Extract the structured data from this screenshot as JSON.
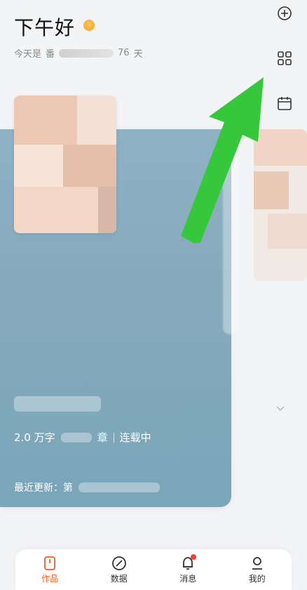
{
  "header": {
    "greeting": "下午好",
    "subtitle_prefix": "今天是",
    "subtitle_fragment1": "番",
    "subtitle_number": "76",
    "subtitle_suffix": "天"
  },
  "right_icons": [
    "plus-circle-icon",
    "grid-icon",
    "calendar-icon"
  ],
  "card": {
    "word_count_prefix": "2.0 万字",
    "status_prefix_char": "章",
    "status": "连载中",
    "latest_update_prefix": "最近更新：第"
  },
  "actions": [
    "settings-hexagon-icon",
    "outline-icon",
    "feather-pen-icon"
  ],
  "colors": {
    "accent": "#ff5a1f",
    "card": "#86aabc",
    "arrow": "#34c83a",
    "badge": "#ff3b30"
  },
  "tabs": [
    {
      "label": "作品",
      "active": true
    },
    {
      "label": "数据",
      "active": false
    },
    {
      "label": "消息",
      "active": false,
      "badge": true
    },
    {
      "label": "我的",
      "active": false
    }
  ]
}
